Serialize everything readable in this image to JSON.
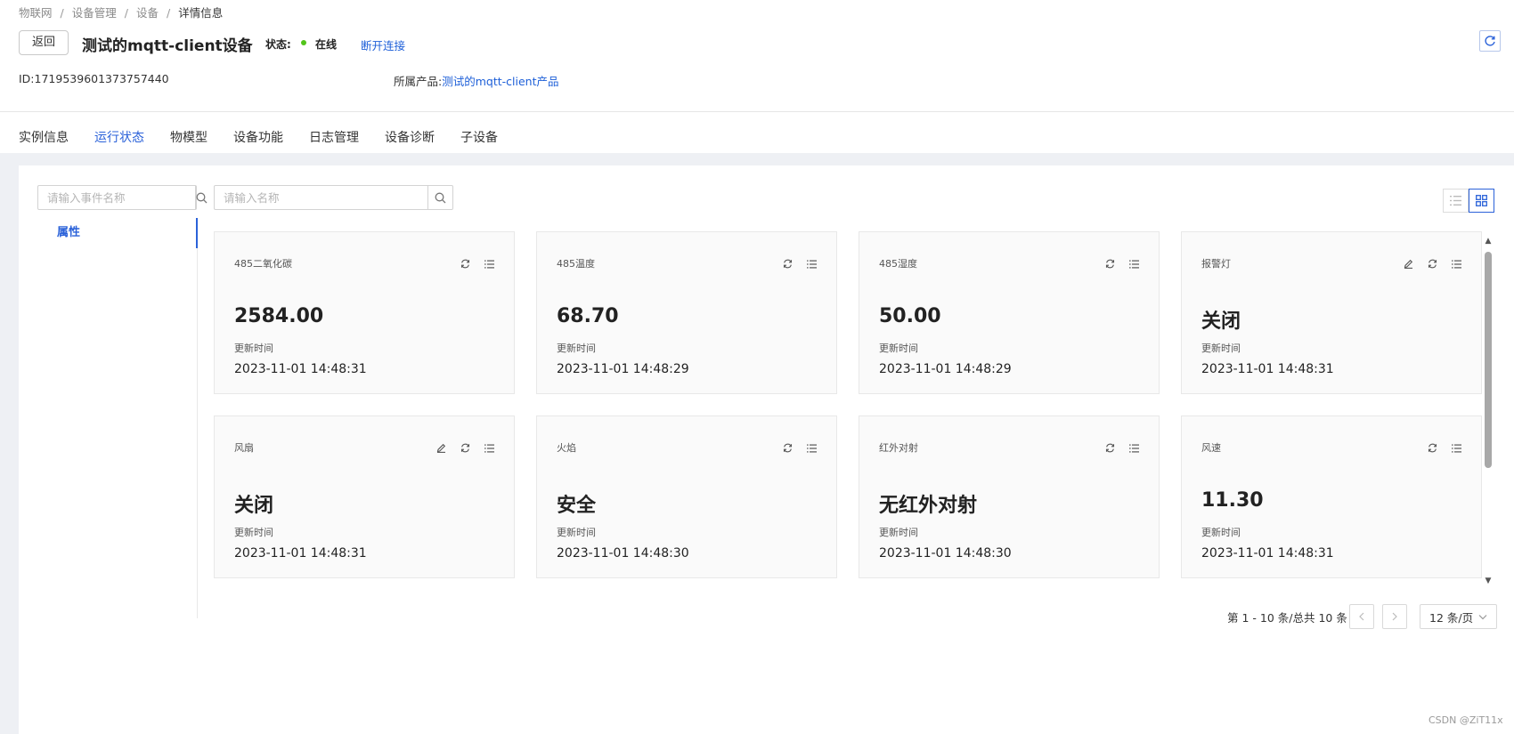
{
  "breadcrumb": [
    "物联网",
    "设备管理",
    "设备",
    "详情信息"
  ],
  "header": {
    "back_label": "返回",
    "device_name": "测试的mqtt-client设备",
    "status_label": "状态:",
    "status_value": "在线",
    "status_color": "#52c41a",
    "disconnect_label": "断开连接",
    "refresh_icon": "refresh-icon"
  },
  "info": {
    "id_label": "ID:",
    "id_value": "1719539601373757440",
    "product_label": "所属产品:",
    "product_value": "测试的mqtt-client产品"
  },
  "tabs": [
    {
      "label": "实例信息",
      "active": false
    },
    {
      "label": "运行状态",
      "active": true
    },
    {
      "label": "物模型",
      "active": false
    },
    {
      "label": "设备功能",
      "active": false
    },
    {
      "label": "日志管理",
      "active": false
    },
    {
      "label": "设备诊断",
      "active": false
    },
    {
      "label": "子设备",
      "active": false
    }
  ],
  "left_panel": {
    "event_search_placeholder": "请输入事件名称",
    "nav_items": [
      {
        "label": "属性",
        "active": true
      }
    ]
  },
  "main": {
    "name_search_placeholder": "请输入名称",
    "view_mode": "grid",
    "cards": [
      {
        "name": "485二氧化碳",
        "value": "2584.00",
        "time_label": "更新时间",
        "time": "2023-11-01 14:48:31",
        "editable": false
      },
      {
        "name": "485温度",
        "value": "68.70",
        "time_label": "更新时间",
        "time": "2023-11-01 14:48:29",
        "editable": false
      },
      {
        "name": "485湿度",
        "value": "50.00",
        "time_label": "更新时间",
        "time": "2023-11-01 14:48:29",
        "editable": false
      },
      {
        "name": "报警灯",
        "value": "关闭",
        "time_label": "更新时间",
        "time": "2023-11-01 14:48:31",
        "editable": true
      },
      {
        "name": "风扇",
        "value": "关闭",
        "time_label": "更新时间",
        "time": "2023-11-01 14:48:31",
        "editable": true
      },
      {
        "name": "火焰",
        "value": "安全",
        "time_label": "更新时间",
        "time": "2023-11-01 14:48:30",
        "editable": false
      },
      {
        "name": "红外对射",
        "value": "无红外对射",
        "time_label": "更新时间",
        "time": "2023-11-01 14:48:30",
        "editable": false
      },
      {
        "name": "风速",
        "value": "11.30",
        "time_label": "更新时间",
        "time": "2023-11-01 14:48:31",
        "editable": false
      }
    ]
  },
  "pagination": {
    "info": "第 1 - 10 条/总共 10 条",
    "page_size": "12 条/页"
  },
  "watermark": "CSDN @ZiT11x",
  "colors": {
    "accent": "#2b62d9",
    "link": "#1d5fd8"
  }
}
